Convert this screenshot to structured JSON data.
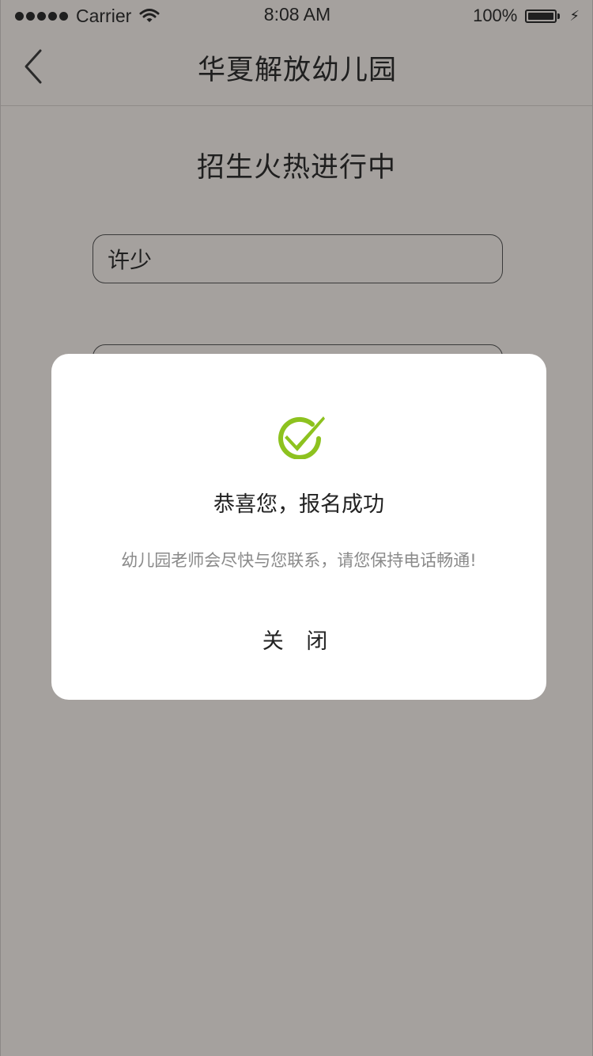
{
  "status_bar": {
    "carrier": "Carrier",
    "time": "8:08 AM",
    "battery": "100%"
  },
  "nav": {
    "title": "华夏解放幼儿园",
    "back_icon": "chevron-left-icon"
  },
  "page": {
    "heading": "招生火热进行中",
    "name_field_value": "许少"
  },
  "modal": {
    "icon": "check-circle-icon",
    "title": "恭喜您，报名成功",
    "message": "幼儿园老师会尽快与您联系，请您保持电话畅通!",
    "close_label": "关 闭"
  },
  "colors": {
    "overlay_background": "#a5a19e",
    "modal_background": "#ffffff",
    "success_green": "#8dc21f",
    "message_gray": "#8a8a8a"
  }
}
